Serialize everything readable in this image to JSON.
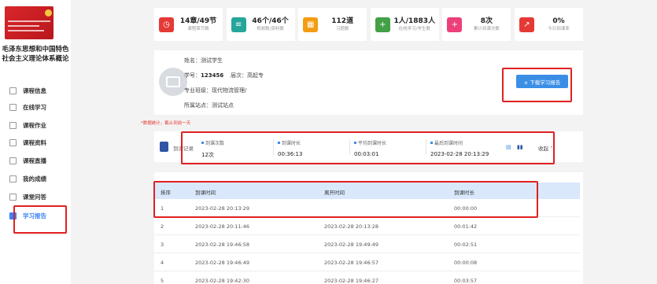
{
  "sidebar": {
    "course_title": "毛泽东思想和中国特色社会主义理论体系概论",
    "items": [
      {
        "label": "课程信息",
        "icon": "info-doc-icon"
      },
      {
        "label": "在线学习",
        "icon": "monitor-icon"
      },
      {
        "label": "课程作业",
        "icon": "homework-icon"
      },
      {
        "label": "课程资料",
        "icon": "folder-icon"
      },
      {
        "label": "课程直播",
        "icon": "video-icon"
      },
      {
        "label": "我的成绩",
        "icon": "score-icon"
      },
      {
        "label": "课堂问答",
        "icon": "question-icon"
      },
      {
        "label": "学习报告",
        "icon": "report-icon"
      }
    ]
  },
  "stats": [
    {
      "value": "14章/49节",
      "label": "课程章节数",
      "color": "#e53935",
      "icon": "clock-icon"
    },
    {
      "value": "46个/46个",
      "label": "视频数/资料数",
      "color": "#26a69a",
      "icon": "document-icon"
    },
    {
      "value": "112道",
      "label": "习题数",
      "color": "#f39c12",
      "icon": "grid-icon"
    },
    {
      "value": "1人/1883人",
      "label": "在线学习/学生数",
      "color": "#43a047",
      "icon": "plus-icon"
    },
    {
      "value": "8次",
      "label": "累计到课次数",
      "color": "#ec407a",
      "icon": "file-icon"
    },
    {
      "value": "0%",
      "label": "今日到课率",
      "color": "#e53935",
      "icon": "chart-icon"
    }
  ],
  "profile": {
    "name_label": "姓名：",
    "name": "测试学生",
    "id_label": "学号：",
    "id": "123456",
    "level_label": "层次：",
    "level": "高起专",
    "major_label": "专业班级：",
    "major": "现代物流管理/",
    "site_label": "所属站点：",
    "site": "测试站点",
    "download_label": "± 下载学习报告"
  },
  "note": "*数据统计，截止到前一天",
  "summary": {
    "label": "到课记录",
    "metrics": [
      {
        "label": "到课次数",
        "value": "12次"
      },
      {
        "label": "到课时长",
        "value": "00:36:13"
      },
      {
        "label": "平均到课时长",
        "value": "00:03:01"
      },
      {
        "label": "最后到课时间",
        "value": "2023-02-28 20:13:29"
      }
    ],
    "collapse_label": "收起"
  },
  "table": {
    "headers": [
      "排序",
      "到课时间",
      "离开时间",
      "到课时长"
    ],
    "rows": [
      [
        "1",
        "2023-02-28 20:13:29",
        "",
        "00:00:00"
      ],
      [
        "2",
        "2023-02-28 20:11:46",
        "2023-02-28 20:13:28",
        "00:01:42"
      ],
      [
        "3",
        "2023-02-28 19:46:58",
        "2023-02-28 19:49:49",
        "00:02:51"
      ],
      [
        "4",
        "2023-02-28 19:46:49",
        "2023-02-28 19:46:57",
        "00:00:08"
      ],
      [
        "5",
        "2023-02-28 19:42:30",
        "2023-02-28 19:46:27",
        "00:03:57"
      ]
    ]
  },
  "colors": {
    "accent": "#3a8ee6",
    "highlight": "#e02020"
  }
}
